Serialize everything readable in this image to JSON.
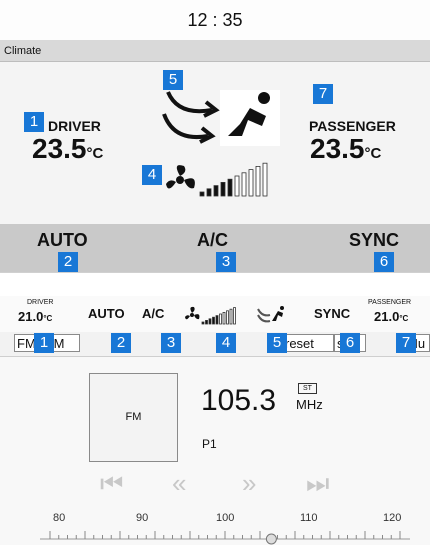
{
  "clock": {
    "time": "12 : 35"
  },
  "climate_panel": {
    "header": "Climate",
    "driver": {
      "label": "DRIVER",
      "temp_value": "23.5",
      "unit": "°C"
    },
    "passenger": {
      "label": "PASSENGER",
      "temp_value": "23.5",
      "unit": "°C"
    },
    "fan_level_fraction": 0.5,
    "buttons": {
      "auto": "AUTO",
      "ac": "A/C",
      "sync": "SYNC"
    }
  },
  "status_strip": {
    "driver": {
      "label": "DRIVER",
      "temp_value": "21.0",
      "unit": "°C"
    },
    "passenger": {
      "label": "PASSENGER",
      "temp_value": "21.0",
      "unit": "°C"
    },
    "auto": "AUTO",
    "ac": "A/C",
    "sync": "SYNC",
    "fan_level_fraction": 0.5
  },
  "tabs": [
    {
      "label": "FM"
    },
    {
      "label": "AM"
    },
    {
      "label": "reset"
    },
    {
      "label": "st"
    },
    {
      "label": "Mu"
    }
  ],
  "radio": {
    "art_label": "FM",
    "frequency": "105.3",
    "unit": "MHz",
    "stereo_badge": "ST",
    "preset": "P1",
    "nav": {
      "skip_back": "⏮",
      "seek_back": "«",
      "seek_forward": "»",
      "skip_forward": "⏭"
    },
    "scale_labels": [
      "80",
      "90",
      "100",
      "110",
      "120"
    ],
    "tuned_frequency": 105.3
  },
  "callouts": [
    "1",
    "2",
    "3",
    "4",
    "5",
    "6",
    "7"
  ],
  "colors": {
    "callout_bg": "#1877d6",
    "panel_bg": "#f4f4f4",
    "bar_bg": "#c9c9c9",
    "disabled": "#c8c8c8"
  }
}
